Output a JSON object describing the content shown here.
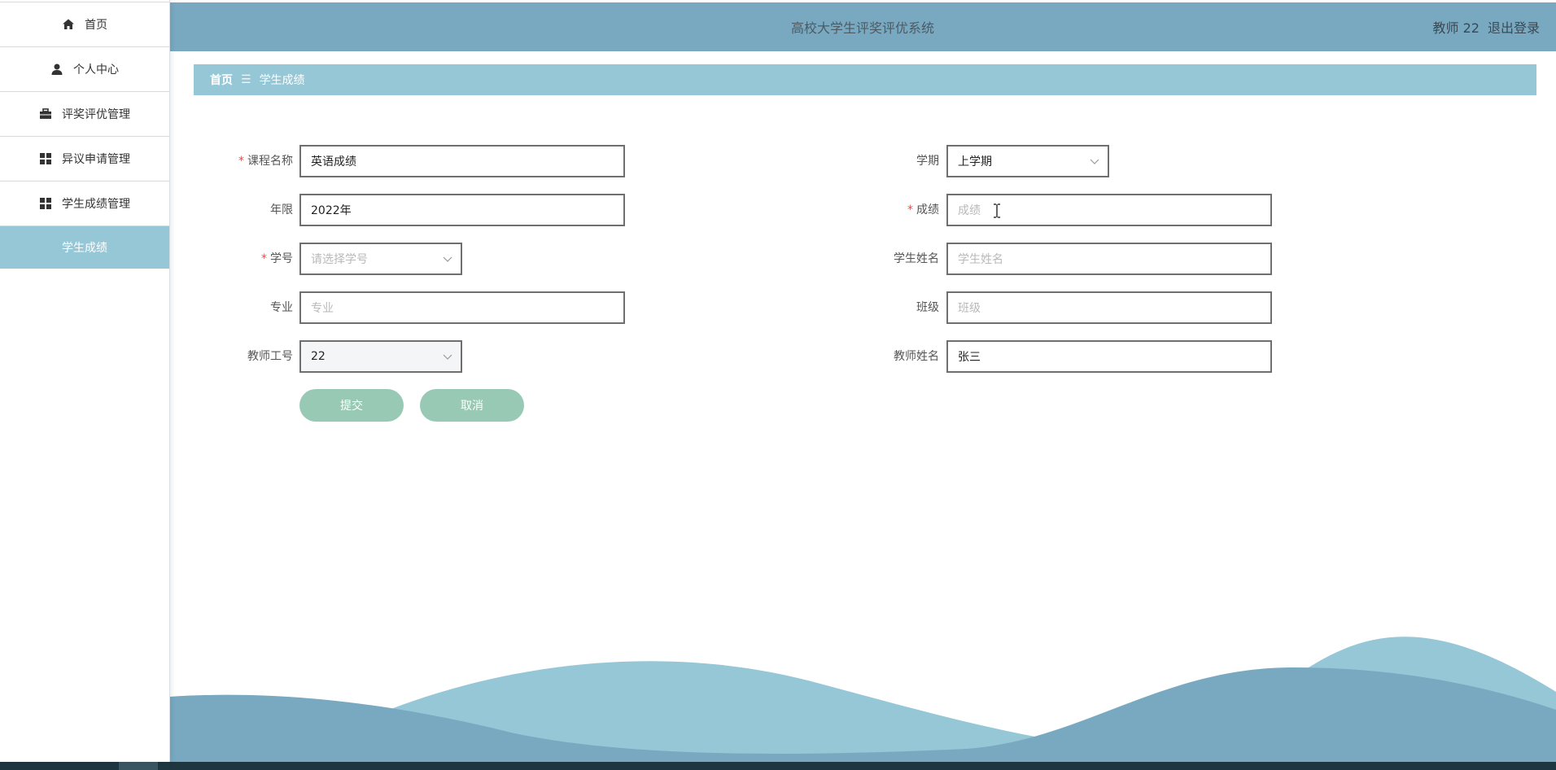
{
  "header": {
    "title": "高校大学生评奖评优系统",
    "user_label": "教师 22",
    "logout": "退出登录"
  },
  "sidebar": {
    "items": [
      {
        "label": "首页",
        "icon": "home-icon"
      },
      {
        "label": "个人中心",
        "icon": "user-icon"
      },
      {
        "label": "评奖评优管理",
        "icon": "briefcase-icon"
      },
      {
        "label": "异议申请管理",
        "icon": "grid-icon"
      },
      {
        "label": "学生成绩管理",
        "icon": "grid-icon"
      }
    ],
    "sub_item": "学生成绩"
  },
  "breadcrumb": {
    "home": "首页",
    "separator": "☰",
    "current": "学生成绩"
  },
  "form": {
    "course_name": {
      "label": "课程名称",
      "value": "英语成绩",
      "required": true
    },
    "semester": {
      "label": "学期",
      "value": "上学期"
    },
    "year": {
      "label": "年限",
      "value": "2022年"
    },
    "score": {
      "label": "成绩",
      "placeholder": "成绩",
      "required": true
    },
    "student_id": {
      "label": "学号",
      "placeholder": "请选择学号",
      "required": true
    },
    "student_name": {
      "label": "学生姓名",
      "placeholder": "学生姓名"
    },
    "major": {
      "label": "专业",
      "placeholder": "专业"
    },
    "class": {
      "label": "班级",
      "placeholder": "班级"
    },
    "teacher_id": {
      "label": "教师工号",
      "value": "22"
    },
    "teacher_name": {
      "label": "教师姓名",
      "value": "张三"
    },
    "submit": "提交",
    "cancel": "取消",
    "required_mark": "*"
  },
  "colors": {
    "header_bg": "#78a9c1",
    "accent_light": "#96c7d6",
    "button": "#98c9b5",
    "wave_light": "#96c7d6",
    "wave_dark": "#78a9c1"
  }
}
